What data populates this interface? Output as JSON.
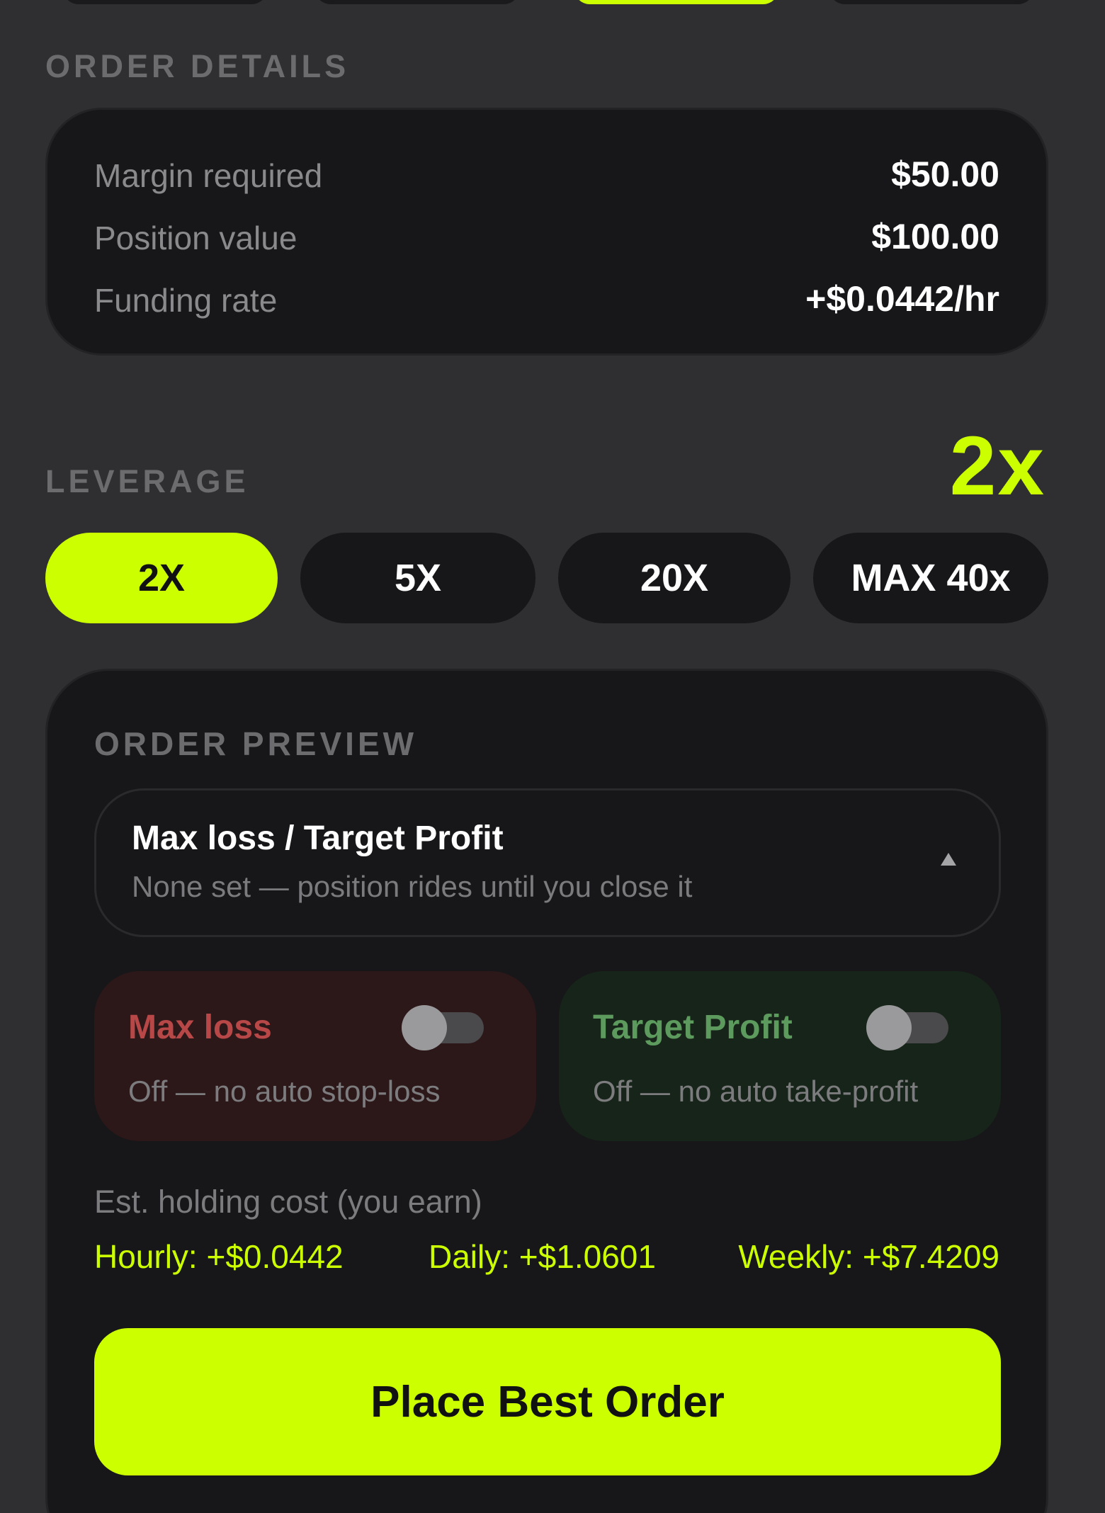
{
  "colors": {
    "accent": "#ccff00",
    "background": "#2f2f31",
    "card": "#17171a",
    "loss": "#b84747",
    "profit": "#5d9a5d"
  },
  "order_details": {
    "label": "ORDER DETAILS",
    "rows": [
      {
        "label": "Margin required",
        "value": "$50.00"
      },
      {
        "label": "Position value",
        "value": "$100.00"
      },
      {
        "label": "Funding rate",
        "value": "+$0.0442/hr"
      }
    ]
  },
  "leverage": {
    "label": "LEVERAGE",
    "current": "2x",
    "options": [
      {
        "label": "2X",
        "selected": true
      },
      {
        "label": "5X",
        "selected": false
      },
      {
        "label": "20X",
        "selected": false
      },
      {
        "label": "MAX 40x",
        "selected": false
      }
    ]
  },
  "order_preview": {
    "label": "ORDER PREVIEW",
    "dropdown": {
      "title": "Max loss / Target Profit",
      "subtitle": "None set — position rides until you close it",
      "icon": "caret-up-icon"
    },
    "max_loss": {
      "title": "Max loss",
      "status": "Off — no auto stop-loss",
      "enabled": false
    },
    "target_profit": {
      "title": "Target Profit",
      "status": "Off — no auto take-profit",
      "enabled": false
    },
    "holding_cost": {
      "label": "Est. holding cost (you earn)",
      "hourly": "Hourly: +$0.0442",
      "daily": "Daily: +$1.0601",
      "weekly": "Weekly: +$7.4209"
    },
    "submit_label": "Place Best Order"
  }
}
